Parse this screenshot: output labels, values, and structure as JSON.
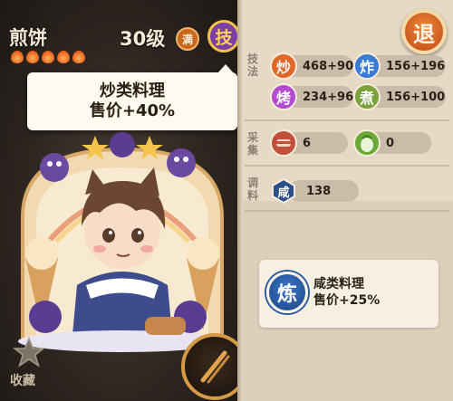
{
  "character": {
    "name": "煎饼",
    "rarity_flames": 5,
    "level": "30级",
    "max_badge": "满",
    "skill_badge": "技"
  },
  "tooltip": {
    "line1": "炒类料理",
    "line2": "售价+40%"
  },
  "collect": {
    "label": "收藏"
  },
  "retreat": {
    "label": "退"
  },
  "sections": {
    "skills": "技法",
    "gather": "采集",
    "seasoning": "调料"
  },
  "skills": [
    {
      "icon_char": "炒",
      "value": "468+90",
      "color": "#e0672a"
    },
    {
      "icon_char": "炸",
      "value": "156+196",
      "color": "#3a7bd5"
    },
    {
      "icon_char": "烤",
      "value": "234+96",
      "color": "#b24bd1"
    },
    {
      "icon_char": "煮",
      "value": "156+100",
      "color": "#7aa23a"
    }
  ],
  "gather": [
    {
      "icon": "meat-icon",
      "value": "6"
    },
    {
      "icon": "vegetable-icon",
      "value": "0"
    }
  ],
  "seasoning": {
    "icon_char": "咸",
    "value": "138",
    "color": "#2b4f8a"
  },
  "refine": {
    "icon_char": "炼",
    "line1": "咸类料理",
    "line2": "售价+25%"
  }
}
